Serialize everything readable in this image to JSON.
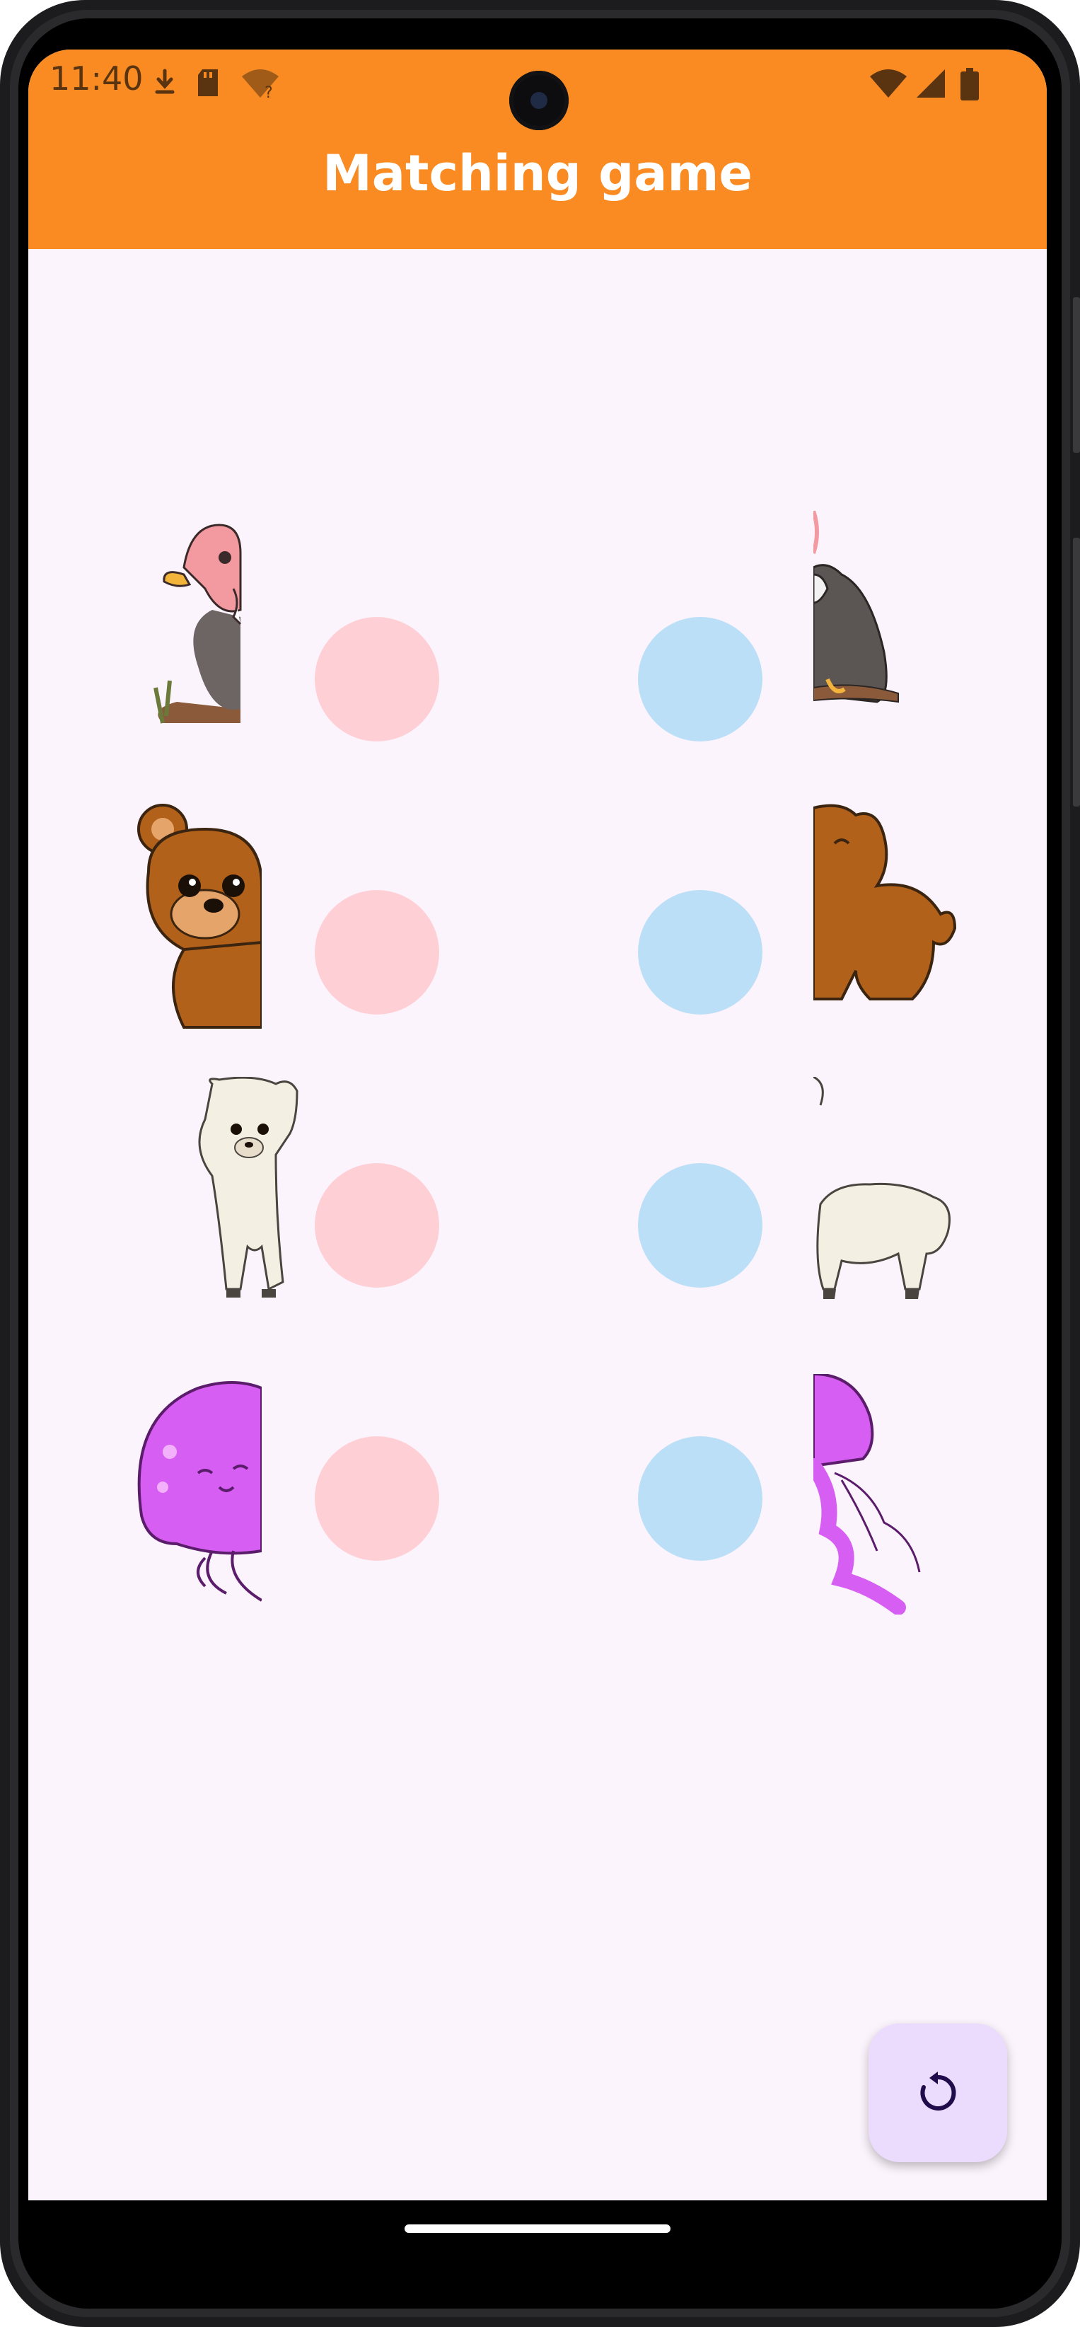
{
  "status_bar": {
    "time": "11:40",
    "left_icons": [
      "download-icon",
      "sd-card-icon",
      "wifi-question-icon"
    ],
    "right_icons": [
      "wifi-icon",
      "signal-icon",
      "battery-icon"
    ]
  },
  "app_bar": {
    "title": "Matching game",
    "color": "#f98b22"
  },
  "game": {
    "rows": [
      {
        "left_half": "vulture-left-half",
        "right_half": "vulture-right-half"
      },
      {
        "left_half": "bear-left-half",
        "right_half": "bear-right-half"
      },
      {
        "left_half": "alpaca-left-half",
        "right_half": "alpaca-right-half"
      },
      {
        "left_half": "jellyfish-left-half",
        "right_half": "jellyfish-right-half"
      }
    ],
    "left_dot_color": "#ffcfd6",
    "right_dot_color": "#bcdff8"
  },
  "fab": {
    "icon": "restart-icon"
  }
}
